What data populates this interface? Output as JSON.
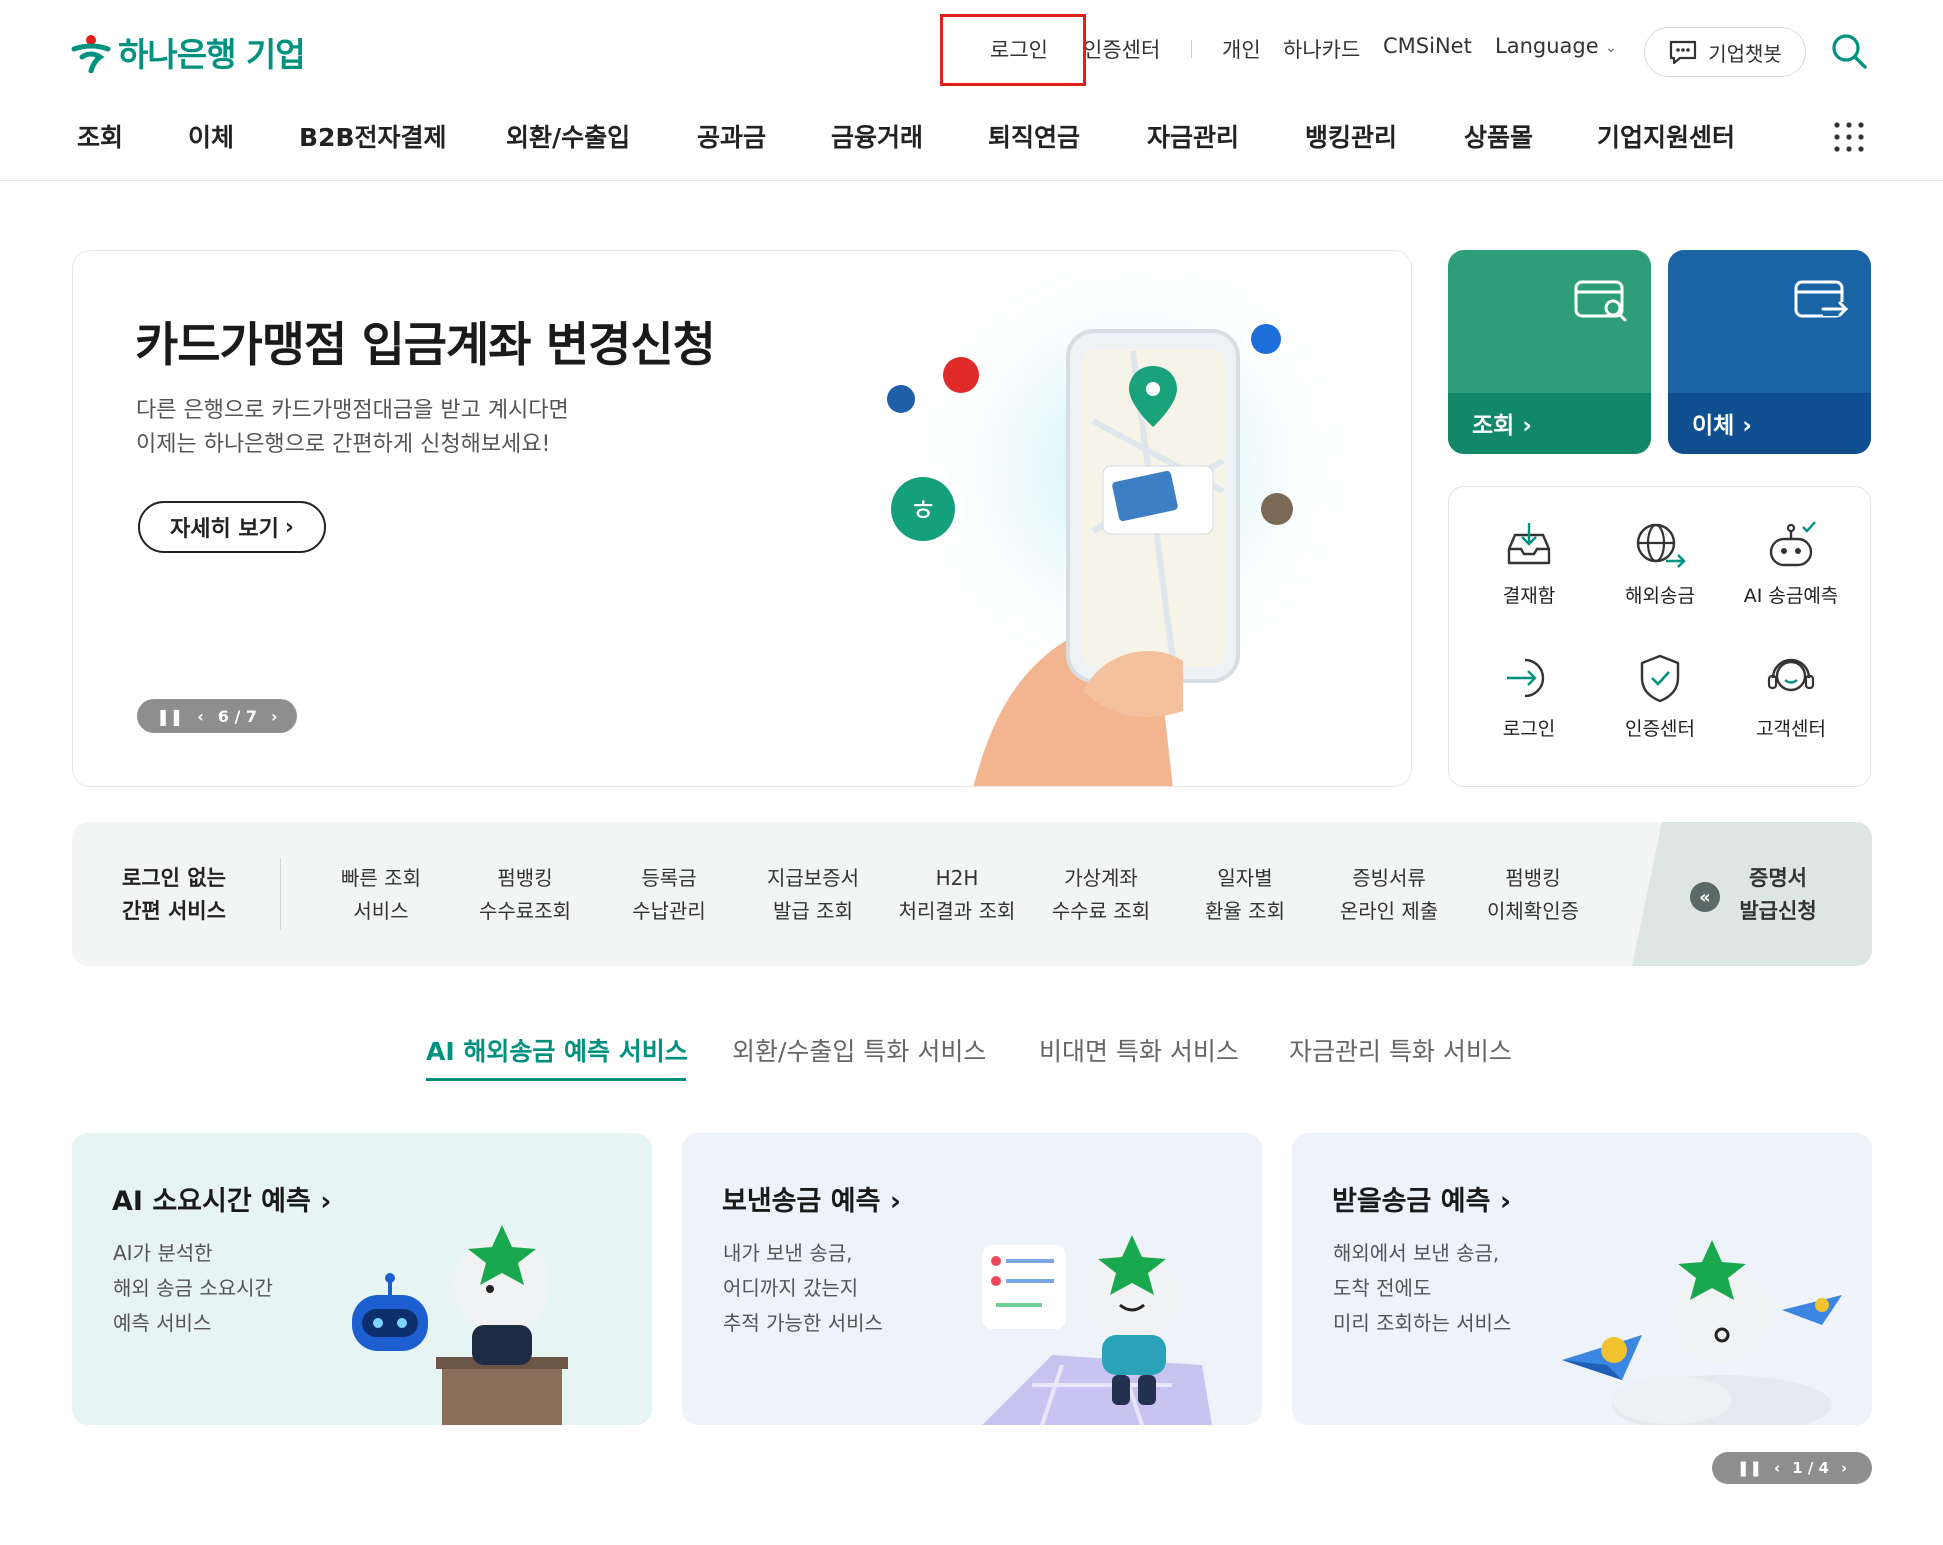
{
  "brand": {
    "logo_text": "하나은행 기업",
    "color": "#00917f"
  },
  "util_nav": {
    "login": "로그인",
    "cert_center": "인증센터",
    "personal": "개인",
    "hanacard": "하나카드",
    "cmsinet": "CMSiNet",
    "language": "Language",
    "chatbot": "기업챗봇"
  },
  "gnb": {
    "items": [
      "조회",
      "이체",
      "B2B전자결제",
      "외환/수출입",
      "공과금",
      "금융거래",
      "퇴직연금",
      "자금관리",
      "뱅킹관리",
      "상품몰",
      "기업지원센터"
    ]
  },
  "hero": {
    "title": "카드가맹점 입금계좌 변경신청",
    "desc_line1": "다른 은행으로 카드가맹점대금을 받고 계시다면",
    "desc_line2": "이제는 하나은행으로 간편하게 신청해보세요!",
    "button": "자세히 보기",
    "pager": "6 / 7"
  },
  "tiles": {
    "inquiry": "조회",
    "transfer": "이체"
  },
  "quick_menu": [
    "결재함",
    "해외송금",
    "AI 송금예측",
    "로그인",
    "인증센터",
    "고객센터"
  ],
  "no_login": {
    "head_line1": "로그인 없는",
    "head_line2": "간편 서비스",
    "items": [
      [
        "빠른 조회",
        "서비스"
      ],
      [
        "펌뱅킹",
        "수수료조회"
      ],
      [
        "등록금",
        "수납관리"
      ],
      [
        "지급보증서",
        "발급 조회"
      ],
      [
        "H2H",
        "처리결과 조회"
      ],
      [
        "가상계좌",
        "수수료 조회"
      ],
      [
        "일자별",
        "환율 조회"
      ],
      [
        "증빙서류",
        "온라인 제출"
      ],
      [
        "펌뱅킹",
        "이체확인증"
      ]
    ],
    "cert_line1": "증명서",
    "cert_line2": "발급신청"
  },
  "tabs": [
    "AI 해외송금 예측 서비스",
    "외환/수출입 특화 서비스",
    "비대면 특화 서비스",
    "자금관리 특화 서비스"
  ],
  "cards": [
    {
      "title": "AI 소요시간 예측",
      "lines": [
        "AI가 분석한",
        "해외 송금 소요시간",
        "예측 서비스"
      ]
    },
    {
      "title": "보낸송금 예측",
      "lines": [
        "내가 보낸 송금,",
        "어디까지 갔는지",
        "추적 가능한 서비스"
      ]
    },
    {
      "title": "받을송금 예측",
      "lines": [
        "해외에서 보낸 송금,",
        "도착 전에도",
        "미리 조회하는 서비스"
      ]
    }
  ],
  "bottom_pager": "1 / 4",
  "colors": {
    "accent": "#00917f",
    "tile_green": "#2e9e7a",
    "tile_blue": "#1a64a6",
    "highlight": "#e0201b"
  }
}
